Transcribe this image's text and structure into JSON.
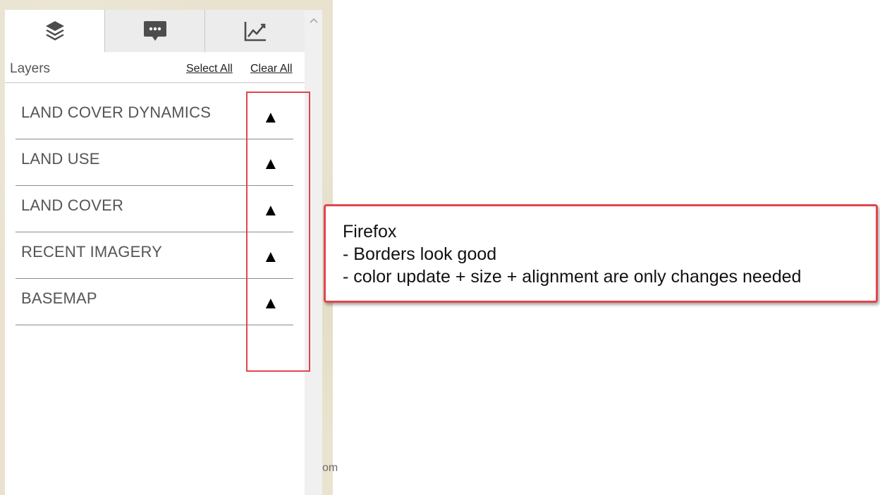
{
  "map": {
    "attribution_fragment": "om"
  },
  "tabs": [
    {
      "icon": "layers-icon",
      "active": true
    },
    {
      "icon": "chat-bubble-icon",
      "active": false
    },
    {
      "icon": "line-chart-icon",
      "active": false
    }
  ],
  "layers_header": {
    "title": "Layers",
    "select_all": "Select All",
    "clear_all": "Clear All"
  },
  "layer_groups": [
    {
      "label": "LAND COVER DYNAMICS",
      "caret": "▲"
    },
    {
      "label": "LAND USE",
      "caret": "▲"
    },
    {
      "label": "LAND COVER",
      "caret": "▲"
    },
    {
      "label": "RECENT IMAGERY",
      "caret": "▲"
    },
    {
      "label": "BASEMAP",
      "caret": "▲"
    }
  ],
  "annotation": {
    "lines": [
      "Firefox",
      "- Borders look good",
      "- color update + size + alignment are only changes needed"
    ],
    "border_color": "#e0464e"
  },
  "colors": {
    "tab_inactive": "#ececec",
    "text_gray": "#555555",
    "annotation_red": "#e0464e"
  }
}
